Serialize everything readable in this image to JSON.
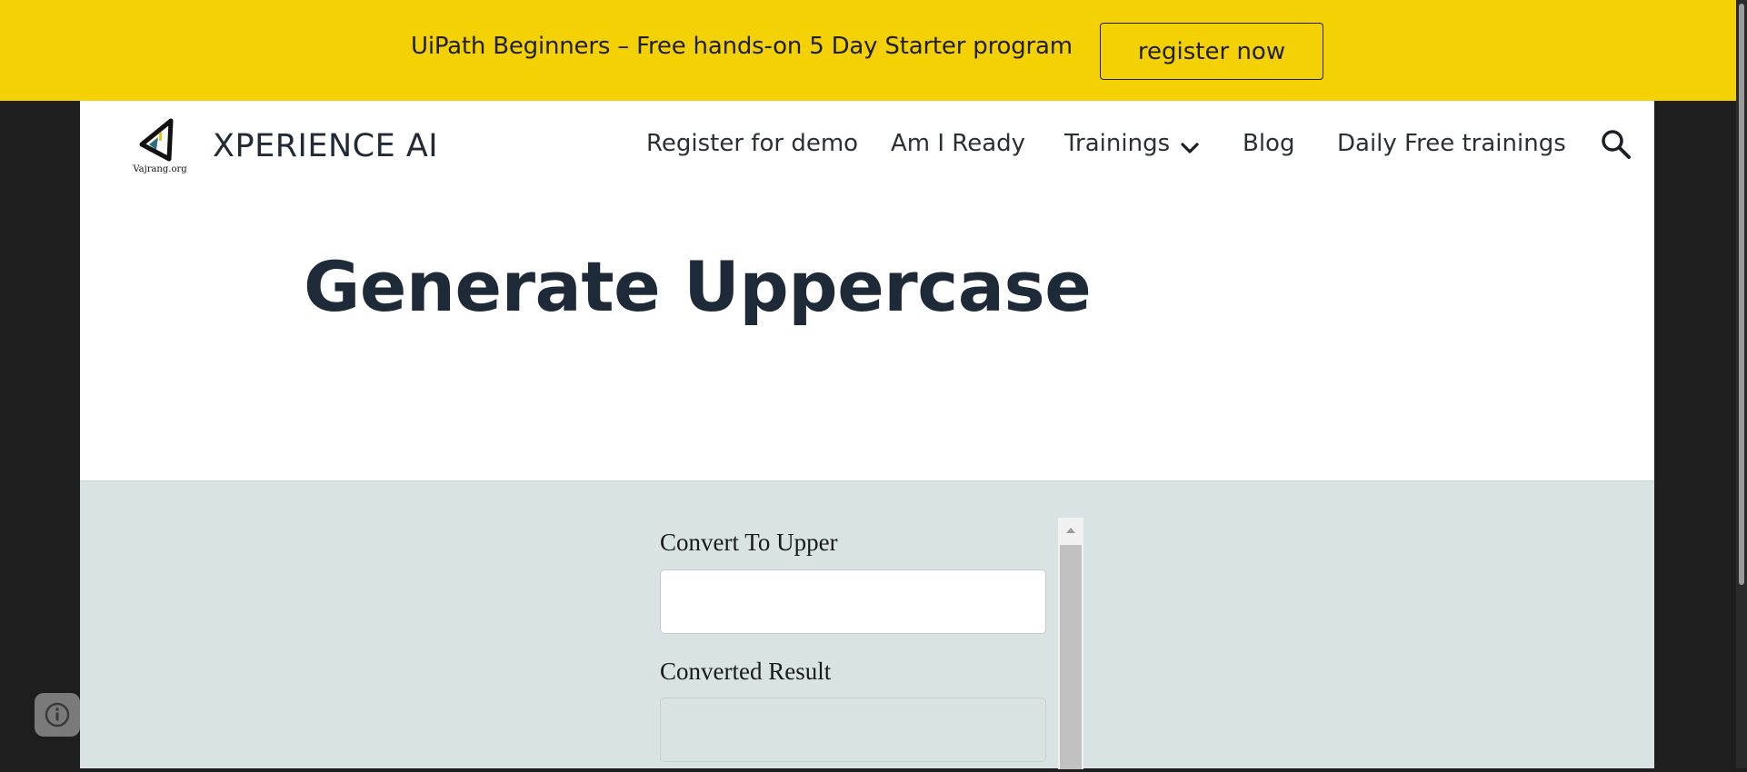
{
  "banner": {
    "text": "UiPath Beginners – Free hands-on 5 Day Starter program",
    "button_label": "register now"
  },
  "header": {
    "logo_caption": "Vajrang.org",
    "site_title": "XPERIENCE AI",
    "nav": {
      "register_demo": "Register for demo",
      "am_i_ready": "Am I Ready",
      "trainings": "Trainings",
      "blog": "Blog",
      "daily_free": "Daily Free trainings"
    },
    "icons": {
      "trainings_dropdown": "chevron-down-icon",
      "search": "search-icon"
    }
  },
  "main": {
    "title": "Generate Uppercase"
  },
  "tool": {
    "input_label": "Convert To Upper",
    "input_value": "",
    "output_label": "Converted Result",
    "output_value": ""
  },
  "colors": {
    "banner_bg": "#f3d104",
    "tool_bg": "#d9e3e3",
    "title_text": "#1e2a38",
    "outer_bg": "#1e1e1e"
  },
  "floating": {
    "icon": "info-icon"
  }
}
